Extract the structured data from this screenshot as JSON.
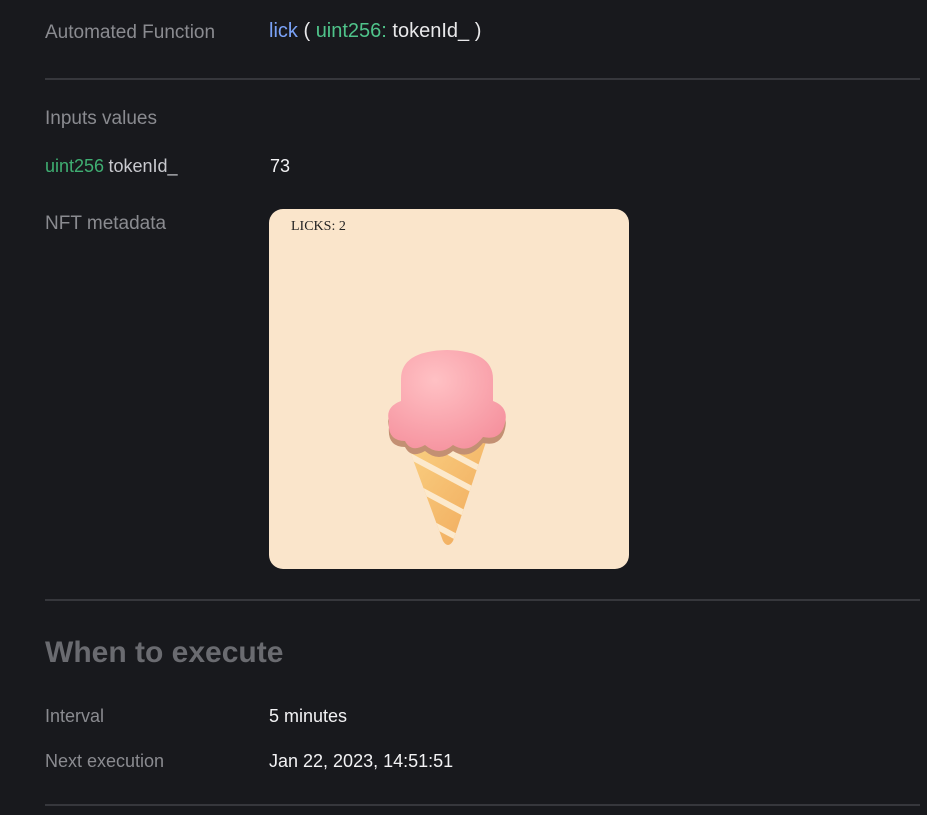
{
  "function_row": {
    "label": "Automated Function",
    "name": "lick",
    "open_paren": "(",
    "param_type": "uint256:",
    "param_name": "tokenId_",
    "close_paren": ")"
  },
  "inputs": {
    "heading": "Inputs values",
    "rows": [
      {
        "type": "uint256",
        "name": "tokenId_",
        "value": "73"
      }
    ]
  },
  "nft": {
    "label": "NFT metadata",
    "licks_text": "LICKS: 2",
    "card_background": "#fae5cb",
    "scoop_color": "#f7a8b0",
    "cone_color": "#f6c16e"
  },
  "schedule": {
    "title": "When to execute",
    "rows": [
      {
        "label": "Interval",
        "value": "5 minutes"
      },
      {
        "label": "Next execution",
        "value": "Jan 22, 2023, 14:51:51"
      }
    ]
  }
}
